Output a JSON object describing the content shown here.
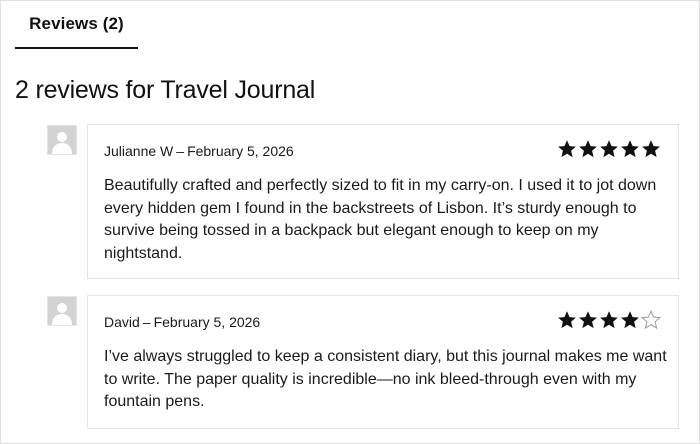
{
  "tab": {
    "label": "Reviews (2)"
  },
  "heading": "2 reviews for Travel Journal",
  "reviews": [
    {
      "author": "Julianne W",
      "separator": "–",
      "date": "February 5, 2026",
      "rating": 5,
      "max_rating": 5,
      "text": "Beautifully crafted and perfectly sized to fit in my carry-on. I used it to jot down every hidden gem I found in the backstreets of Lisbon. It’s sturdy enough to survive being tossed in a backpack but elegant enough to keep on my nightstand."
    },
    {
      "author": "David",
      "separator": "–",
      "date": "February 5, 2026",
      "rating": 4,
      "max_rating": 5,
      "text": "I’ve always struggled to keep a consistent diary, but this journal makes me want to write. The paper quality is incredible—no ink bleed-through even with my fountain pens."
    }
  ],
  "colors": {
    "star_filled": "#111111",
    "star_empty_stroke": "#9a9a9a",
    "avatar_bg": "#d3d3d3"
  },
  "icons": {
    "avatar": "user-silhouette-icon",
    "star": "star-icon"
  }
}
